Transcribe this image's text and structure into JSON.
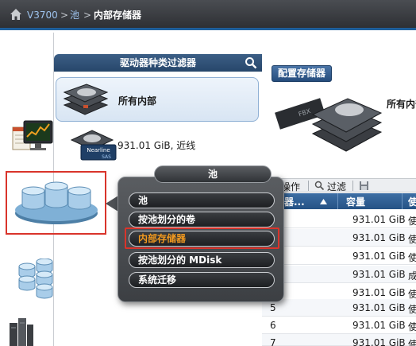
{
  "breadcrumb": {
    "system": "V3700",
    "sep1": ">",
    "level1": "池",
    "sep2": ">",
    "current": "内部存储器"
  },
  "icons": {
    "home": "home-icon",
    "search": "search-icon",
    "performance": "performance-monitor-icon",
    "pools": "pools-icon",
    "volumes": "volumes-icon",
    "hosts": "hosts-icon"
  },
  "filter_panel": {
    "title": "驱动器种类过滤器",
    "all_internal_label": "所有内部",
    "drive_type_badge_line1": "Nearline",
    "drive_type_badge_line2": "SAS",
    "drive_type_text": "931.01 GiB, 近线"
  },
  "main": {
    "configure_button": "配置存储器",
    "all_internal_label": "所有内部",
    "toolbar": {
      "actions": "操作",
      "filter": "过滤"
    },
    "table": {
      "columns": [
        "驱动器...",
        "容量",
        "使"
      ],
      "rows": [
        {
          "id": "",
          "capacity": "931.01 GiB",
          "status": "使"
        },
        {
          "id": "",
          "capacity": "931.01 GiB",
          "status": "使"
        },
        {
          "id": "",
          "capacity": "931.01 GiB",
          "status": "使"
        },
        {
          "id": "",
          "capacity": "931.01 GiB",
          "status": "成"
        },
        {
          "id": "",
          "capacity": "931.01 GiB",
          "status": "使"
        },
        {
          "id": "5",
          "capacity": "931.01 GiB",
          "status": "使"
        },
        {
          "id": "6",
          "capacity": "931.01 GiB",
          "status": "使"
        },
        {
          "id": "7",
          "capacity": "931.01 GiB",
          "status": "使"
        }
      ]
    }
  },
  "popup_menu": {
    "title": "池",
    "items": [
      {
        "label": "池"
      },
      {
        "label": "按池划分的卷"
      },
      {
        "label": "内部存储器",
        "active": true
      },
      {
        "label": "按池划分的 MDisk"
      },
      {
        "label": "系统迁移"
      }
    ]
  },
  "colors": {
    "highlight_red": "#d9342b",
    "active_orange": "#f39a1f",
    "header_blue": "#255285"
  }
}
